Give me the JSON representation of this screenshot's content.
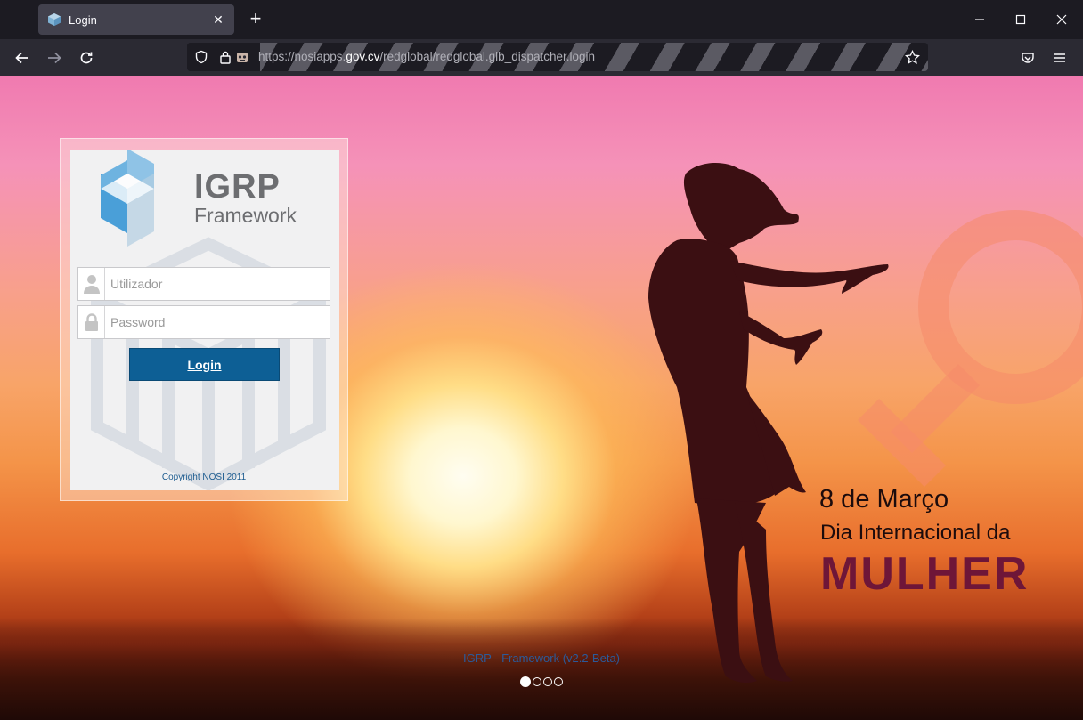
{
  "browser": {
    "tab": {
      "title": "Login",
      "favicon": "igrp-favicon",
      "close": "✕"
    },
    "new_tab": "+",
    "window_controls": [
      "minimize-icon",
      "maximize-icon",
      "close-icon"
    ],
    "nav": [
      "back-icon",
      "forward-icon",
      "reload-icon"
    ],
    "url": {
      "prefix": "https://nosiapps.",
      "domain": "gov.cv",
      "path": "/redglobal/redglobal.glb_dispatcher.login"
    },
    "toolbar_icons": [
      "shield-icon",
      "lock-icon",
      "permissions-icon",
      "bookmark-star-icon",
      "pocket-icon",
      "menu-icon"
    ]
  },
  "login": {
    "brand_line1": "IGRP",
    "brand_line2": "Framework",
    "username_placeholder": "Utilizador",
    "password_placeholder": "Password",
    "login_label": "Login",
    "copyright": "Copyright NOSI 2011"
  },
  "banner": {
    "line1": "8 de Março",
    "line2": "Dia Internacional da",
    "line3": "MULHER"
  },
  "footer": {
    "link": "IGRP - Framework (v2.2-Beta)",
    "carousel_dots": 4,
    "active_dot": 1
  },
  "colors": {
    "button": "#0d5f95",
    "brand_gray": "#6d6e71",
    "mulher": "#6e1638"
  }
}
